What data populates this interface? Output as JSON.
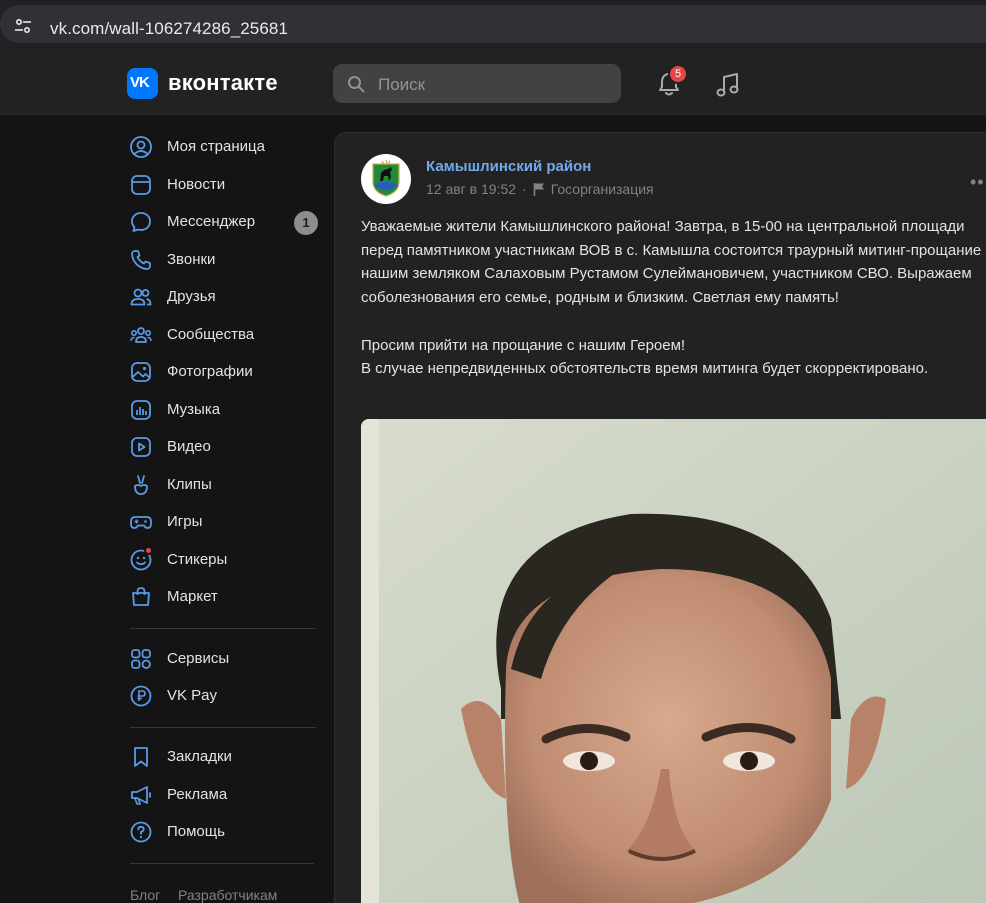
{
  "browser": {
    "url": "vk.com/wall-106274286_25681",
    "site_info_icon": "tune-icon"
  },
  "header": {
    "logo_text": "VK",
    "wordmark": "вконтакте",
    "search_placeholder": "Поиск",
    "notifications_count": "5",
    "accent_color": "#0077ff",
    "badge_color": "#e64646"
  },
  "sidebar": {
    "items": [
      {
        "label": "Моя страница",
        "icon": "user-circle-icon"
      },
      {
        "label": "Новости",
        "icon": "news-icon"
      },
      {
        "label": "Мессенджер",
        "icon": "message-icon",
        "count": "1"
      },
      {
        "label": "Звонки",
        "icon": "phone-icon"
      },
      {
        "label": "Друзья",
        "icon": "friends-icon"
      },
      {
        "label": "Сообщества",
        "icon": "communities-icon"
      },
      {
        "label": "Фотографии",
        "icon": "photo-icon"
      },
      {
        "label": "Музыка",
        "icon": "music-icon"
      },
      {
        "label": "Видео",
        "icon": "video-icon"
      },
      {
        "label": "Клипы",
        "icon": "clips-icon"
      },
      {
        "label": "Игры",
        "icon": "gamepad-icon"
      },
      {
        "label": "Стикеры",
        "icon": "sticker-icon"
      },
      {
        "label": "Маркет",
        "icon": "market-icon"
      }
    ],
    "items2": [
      {
        "label": "Сервисы",
        "icon": "services-icon"
      },
      {
        "label": "VK Pay",
        "icon": "vkpay-icon"
      }
    ],
    "items3": [
      {
        "label": "Закладки",
        "icon": "bookmark-icon"
      },
      {
        "label": "Реклама",
        "icon": "megaphone-icon"
      },
      {
        "label": "Помощь",
        "icon": "help-icon"
      }
    ],
    "footer": [
      "Блог",
      "Разработчикам"
    ]
  },
  "post": {
    "group_name": "Камышлинский район",
    "date": "12 авг в 19:52",
    "separator": "·",
    "category": "Госорганизация",
    "text": "Уважаемые жители Камышлинского района! Завтра, в 15-00 на центральной площади перед памятником участникам ВОВ в с. Камышла состоится траурный митинг-прощание с нашим земляком Салаховым Рустамом Сулеймановичем, участником СВО. Выражаем соболезнования его семье, родным и близким. Светлая ему память!\n\nПросим прийти на прощание с нашим Героем!\nВ случае непредвиденных обстоятельств время митинга будет скорректировано.",
    "more_icon": "more-horizontal-icon"
  }
}
